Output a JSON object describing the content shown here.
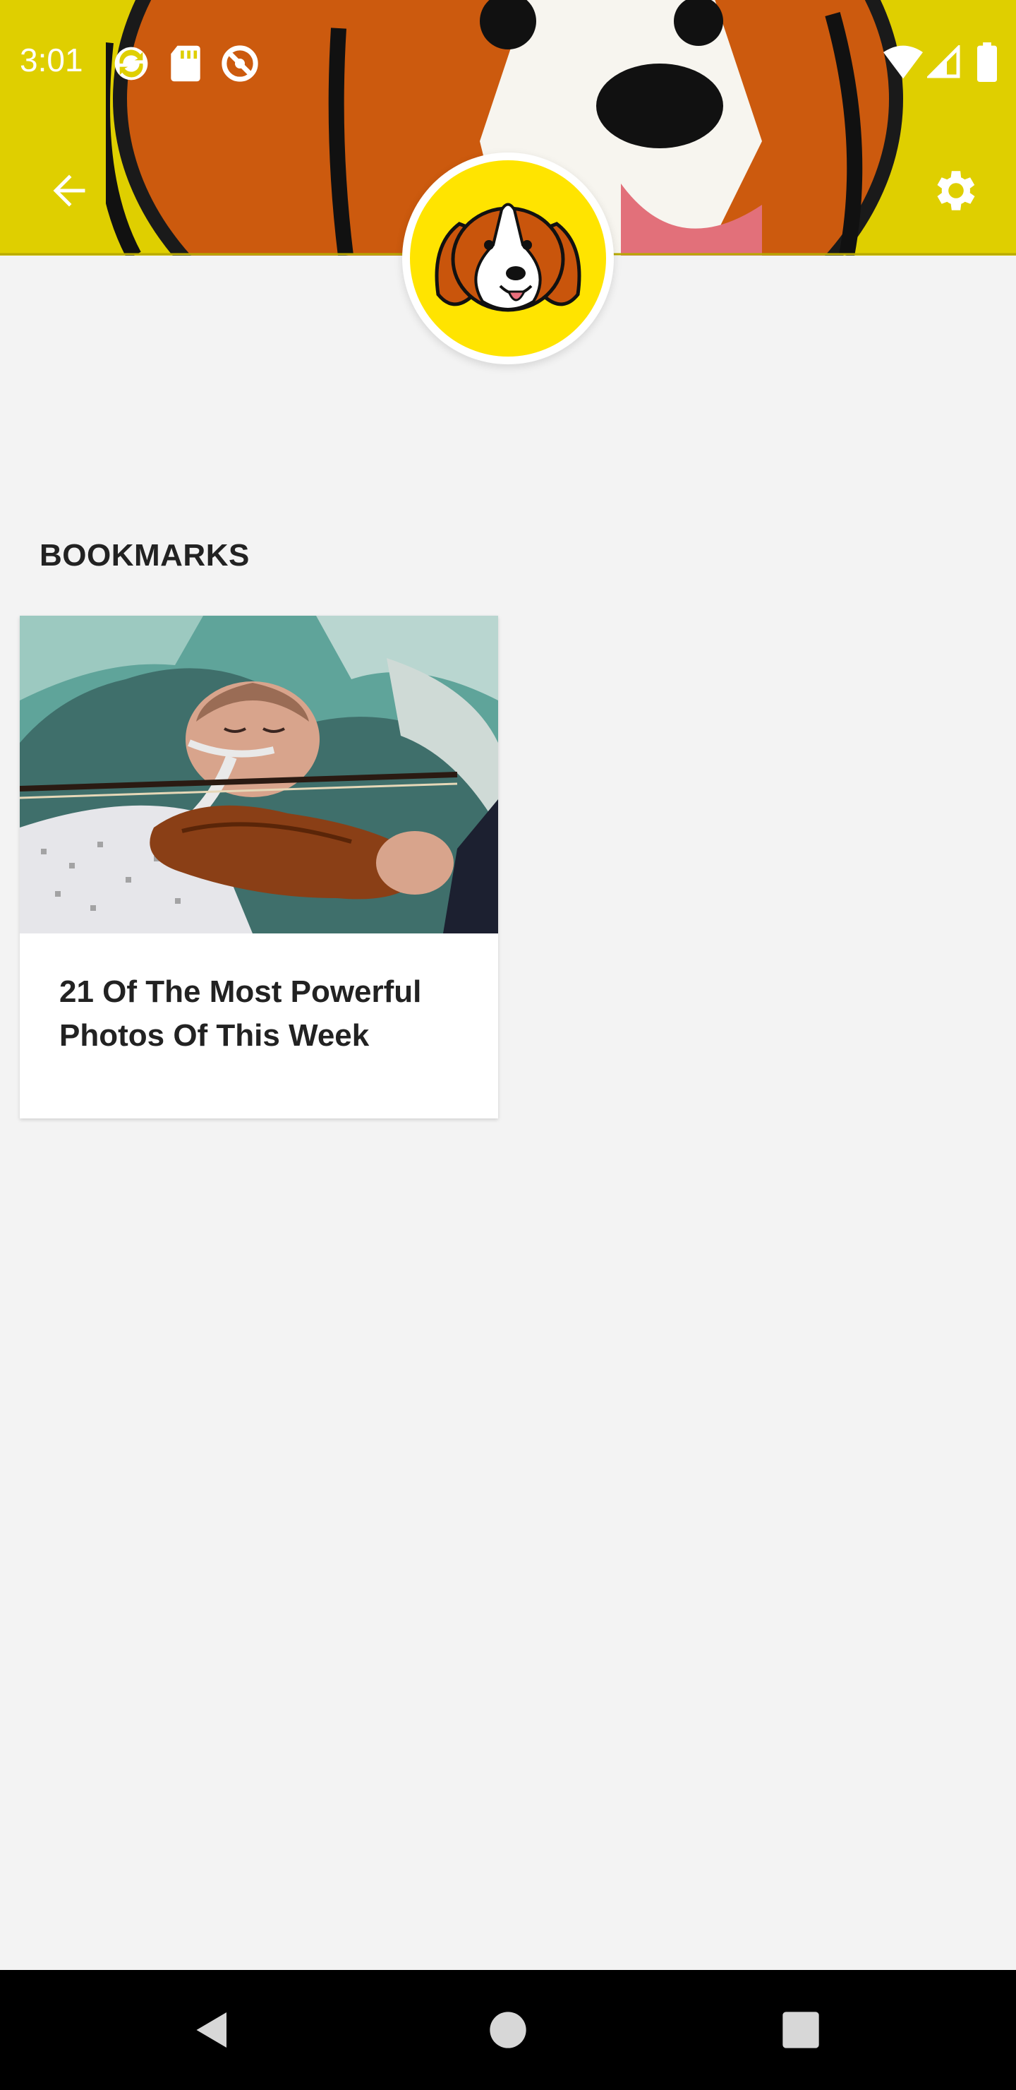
{
  "status_bar": {
    "time": "3:01",
    "left_icons": [
      "sync-icon",
      "sd-card-icon",
      "do-not-disturb-icon"
    ],
    "right_icons": [
      "wifi-icon",
      "cell-signal-icon",
      "battery-icon"
    ]
  },
  "header": {
    "back_icon": "arrow-left-icon",
    "settings_icon": "gear-icon",
    "banner_color": "#dfcf00",
    "avatar_color": "#ffe400"
  },
  "bookmarks": {
    "title": "BOOKMARKS",
    "items": [
      {
        "title": "21 Of The Most Powerful Photos Of This Week"
      }
    ]
  },
  "nav_bar": {
    "buttons": [
      "back-triangle-icon",
      "home-circle-icon",
      "recents-square-icon"
    ]
  }
}
